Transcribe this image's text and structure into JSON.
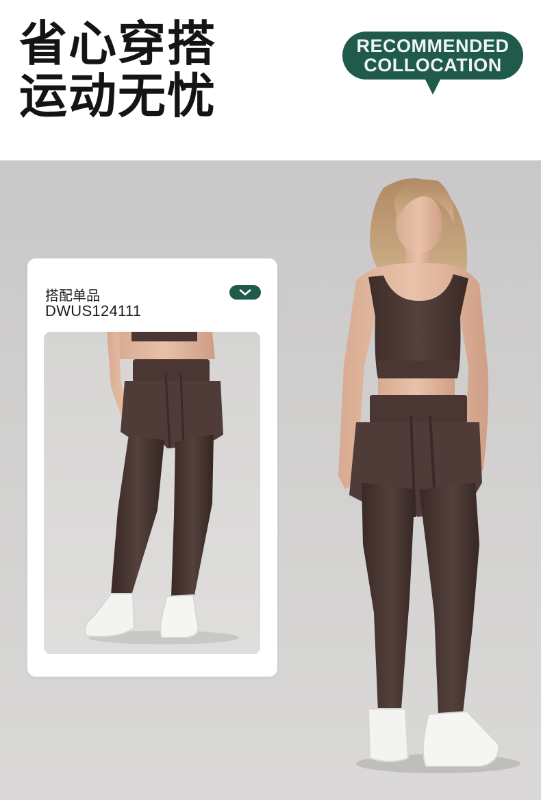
{
  "header": {
    "headline_line1": "省心穿搭",
    "headline_line2": "运动无忧",
    "badge_line1": "RECOMMENDED",
    "badge_line2": "COLLOCATION"
  },
  "card": {
    "label": "搭配单品",
    "product_code": "DWUS124111",
    "expand_icon": "chevron-down-icon"
  },
  "images": {
    "card_image": "matching item: brown two-in-one shorts over leggings",
    "model_image": "model in brown sports top and two-in-one leggings"
  },
  "colors": {
    "accent": "#1f5a4b",
    "garment": "#4b3632",
    "backdrop": "#cfcecd"
  }
}
